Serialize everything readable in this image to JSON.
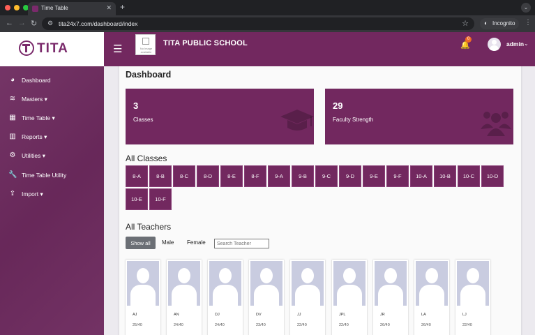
{
  "browser": {
    "tab_title": "Time Table",
    "url": "tita24x7.com/dashboard/index",
    "incognito_label": "Incognito"
  },
  "header": {
    "logo_text": "TITA",
    "school_logo_text": "No Image available",
    "school_name": "TITA PUBLIC SCHOOL",
    "notification_count": "0",
    "user_name": "admin"
  },
  "sidebar": {
    "items": [
      {
        "label": "Dashboard",
        "icon": "dashboard-icon"
      },
      {
        "label": "Masters ▾",
        "icon": "database-icon"
      },
      {
        "label": "Time Table ▾",
        "icon": "calendar-icon"
      },
      {
        "label": "Reports ▾",
        "icon": "chart-icon"
      },
      {
        "label": "Utilities ▾",
        "icon": "gear-icon"
      },
      {
        "label": "Time Table Utility",
        "icon": "wrench-icon"
      },
      {
        "label": "Import ▾",
        "icon": "upload-icon"
      }
    ]
  },
  "dashboard": {
    "title": "Dashboard",
    "stats": [
      {
        "value": "3",
        "label": "Classes",
        "icon": "graduation-cap-icon"
      },
      {
        "value": "29",
        "label": "Faculty Strength",
        "icon": "users-icon"
      }
    ],
    "classes_title": "All Classes",
    "classes": [
      "8-A",
      "8-B",
      "8-C",
      "8-D",
      "8-E",
      "8-F",
      "9-A",
      "9-B",
      "9-C",
      "9-D",
      "9-E",
      "9-F",
      "10-A",
      "10-B",
      "10-C",
      "10-D",
      "10-E",
      "10-F"
    ],
    "teachers_title": "All Teachers",
    "filters": {
      "show_all": "Show all",
      "male": "Male",
      "female": "Female",
      "search_placeholder": "Search Teacher"
    },
    "teachers": [
      {
        "name": "AJ",
        "load": "25/40"
      },
      {
        "name": "AN",
        "load": "24/40"
      },
      {
        "name": "DJ",
        "load": "24/40"
      },
      {
        "name": "DV",
        "load": "23/40"
      },
      {
        "name": "JJ",
        "load": "22/40"
      },
      {
        "name": "JPL",
        "load": "22/40"
      },
      {
        "name": "JR",
        "load": "26/40"
      },
      {
        "name": "LA",
        "load": "26/40"
      },
      {
        "name": "LJ",
        "load": "22/40"
      }
    ]
  },
  "colors": {
    "brand": "#72285f",
    "sidebar": "#6d2a5e"
  }
}
